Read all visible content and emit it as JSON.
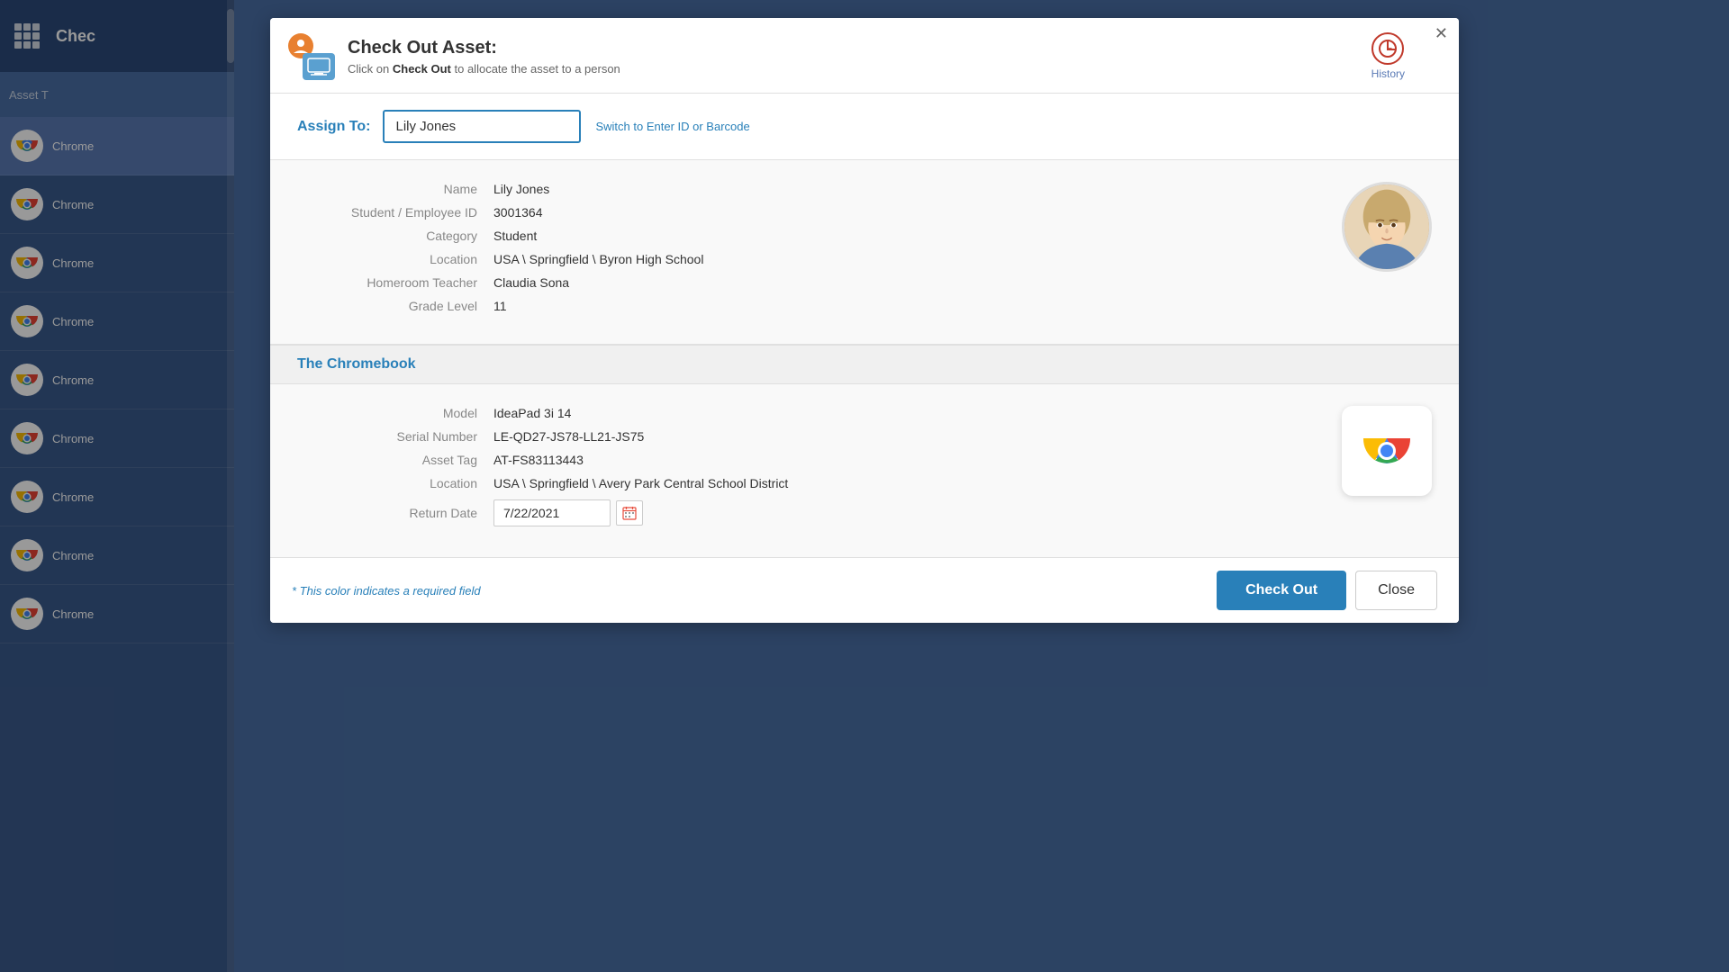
{
  "app": {
    "title": "Chec",
    "grid_icon": "apps-icon"
  },
  "sidebar": {
    "items": [
      {
        "id": 1,
        "label": "Chrome",
        "active": true
      },
      {
        "id": 2,
        "label": "Chrome",
        "active": false
      },
      {
        "id": 3,
        "label": "Chrome",
        "active": false
      },
      {
        "id": 4,
        "label": "Chrome",
        "active": false
      },
      {
        "id": 5,
        "label": "Chrome",
        "active": false
      },
      {
        "id": 6,
        "label": "Chrome",
        "active": false
      },
      {
        "id": 7,
        "label": "Chrome",
        "active": false
      },
      {
        "id": 8,
        "label": "Chrome",
        "active": false
      },
      {
        "id": 9,
        "label": "Chrome",
        "active": false
      }
    ],
    "column_header": "Asset T"
  },
  "modal": {
    "title": "Check Out Asset:",
    "subtitle_prefix": "Click on",
    "subtitle_action": "Check Out",
    "subtitle_suffix": "to allocate the asset to a person",
    "history_label": "History",
    "close_symbol": "✕",
    "assign_label": "Assign To:",
    "assign_value": "Lily Jones",
    "assign_placeholder": "Lily Jones",
    "switch_link": "Switch to Enter ID or Barcode",
    "person": {
      "name_label": "Name",
      "name_value": "Lily Jones",
      "id_label": "Student / Employee ID",
      "id_value": "3001364",
      "category_label": "Category",
      "category_value": "Student",
      "location_label": "Location",
      "location_value": "USA \\ Springfield \\ Byron High School",
      "homeroom_label": "Homeroom Teacher",
      "homeroom_value": "Claudia Sona",
      "grade_label": "Grade Level",
      "grade_value": "11"
    },
    "chromebook_section_title": "The Chromebook",
    "asset": {
      "model_label": "Model",
      "model_value": "IdeaPad 3i 14",
      "serial_label": "Serial Number",
      "serial_value": "LE-QD27-JS78-LL21-JS75",
      "tag_label": "Asset Tag",
      "tag_value": "AT-FS83113443",
      "location_label": "Location",
      "location_value": "USA \\ Springfield \\ Avery Park Central School District",
      "return_label": "Return Date",
      "return_value": "7/22/2021"
    },
    "required_note_prefix": "* ",
    "required_note_colored": "This color",
    "required_note_suffix": " indicates a required field",
    "checkout_button": "Check Out",
    "close_button": "Close"
  },
  "colors": {
    "primary_blue": "#2980b9",
    "header_blue": "#3a5a8c",
    "active_blue": "#5a7ab5",
    "required_color": "#2980b9"
  }
}
